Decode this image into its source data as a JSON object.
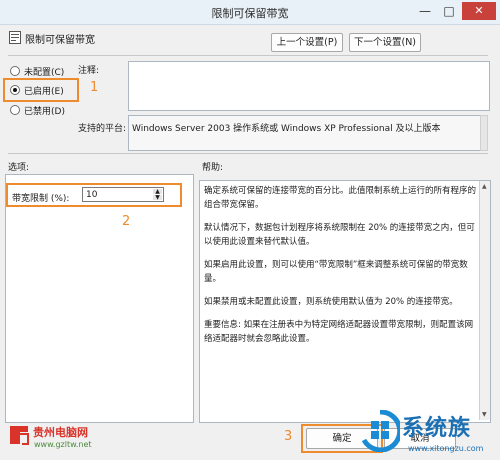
{
  "window": {
    "title": "限制可保留带宽",
    "controls": {
      "minimize": "—",
      "maximize": "□",
      "close": "✕"
    }
  },
  "policy": {
    "name": "限制可保留带宽",
    "icon": "policy-setting-icon"
  },
  "nav": {
    "prev": "上一个设置(P)",
    "next": "下一个设置(N)"
  },
  "options": {
    "not_configured": "未配置(C)",
    "enabled": "已启用(E)",
    "disabled": "已禁用(D)",
    "selected": "enabled"
  },
  "comment": {
    "label": "注释:",
    "value": ""
  },
  "supported": {
    "label": "支持的平台:",
    "value": "Windows Server 2003 操作系统或 Windows XP Professional 及以上版本"
  },
  "sections": {
    "options_label": "选项:",
    "help_label": "帮助:"
  },
  "bandwidth": {
    "label": "带宽限制 (%):",
    "value": "10"
  },
  "help": [
    "确定系统可保留的连接带宽的百分比。此值限制系统上运行的所有程序的组合带宽保留。",
    "默认情况下，数据包计划程序将系统限制在 20% 的连接带宽之内，但可以使用此设置来替代默认值。",
    "如果启用此设置，则可以使用“带宽限制”框来调整系统可保留的带宽数量。",
    "如果禁用或未配置此设置，则系统使用默认值为 20% 的连接带宽。",
    "重要信息: 如果在注册表中为特定网络适配器设置带宽限制，则配置该网络适配器时就会忽略此设置。"
  ],
  "annotations": {
    "n1": "1",
    "n2": "2",
    "n3": "3"
  },
  "footer": {
    "ok": "确定",
    "cancel": "取消"
  },
  "watermarks": {
    "left_brand": "贵州电脑网",
    "left_url": "www.gzltw.net",
    "right_brand": "系统族",
    "right_url": "www.xitongzu.com"
  },
  "colors": {
    "highlight": "#ee8b2f",
    "close": "#c9413b"
  }
}
